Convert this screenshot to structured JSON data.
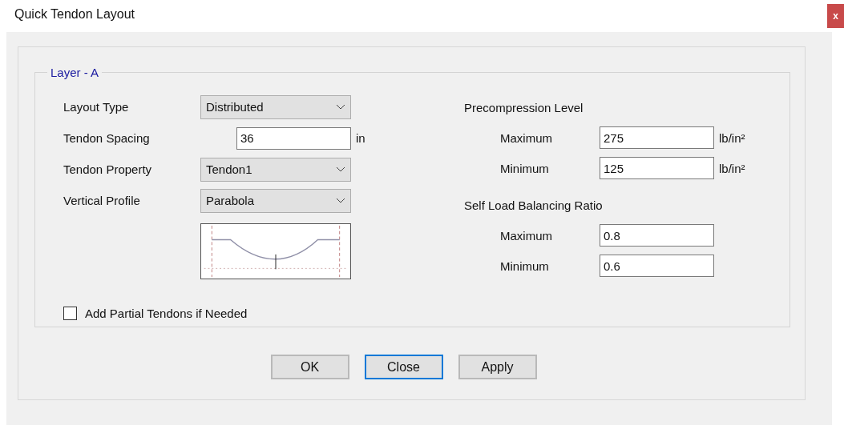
{
  "window": {
    "title": "Quick Tendon Layout",
    "close": "x"
  },
  "group": {
    "title": "Layer - A"
  },
  "left_rows": [
    {
      "kind": "dropdown",
      "label": "Layout Type",
      "value": "Distributed"
    },
    {
      "kind": "input",
      "label": "Tendon Spacing",
      "value": "36",
      "unit": "in"
    },
    {
      "kind": "dropdown",
      "label": "Tendon Property",
      "value": "Tendon1"
    },
    {
      "kind": "dropdown",
      "label": "Vertical Profile",
      "value": "Parabola"
    }
  ],
  "partial_tendons": {
    "label": "Add Partial Tendons if Needed",
    "checked": false
  },
  "sections": [
    {
      "title": "Precompression Level",
      "rows": [
        {
          "label": "Maximum",
          "value": "275",
          "unit": "lb/in²"
        },
        {
          "label": "Minimum",
          "value": "125",
          "unit": "lb/in²"
        }
      ]
    },
    {
      "title": "Self Load Balancing Ratio",
      "rows": [
        {
          "label": "Maximum",
          "value": "0.8"
        },
        {
          "label": "Minimum",
          "value": "0.6"
        }
      ]
    }
  ],
  "buttons": [
    {
      "label": "OK",
      "focused": false
    },
    {
      "label": "Close",
      "focused": true
    },
    {
      "label": "Apply",
      "focused": false
    }
  ]
}
